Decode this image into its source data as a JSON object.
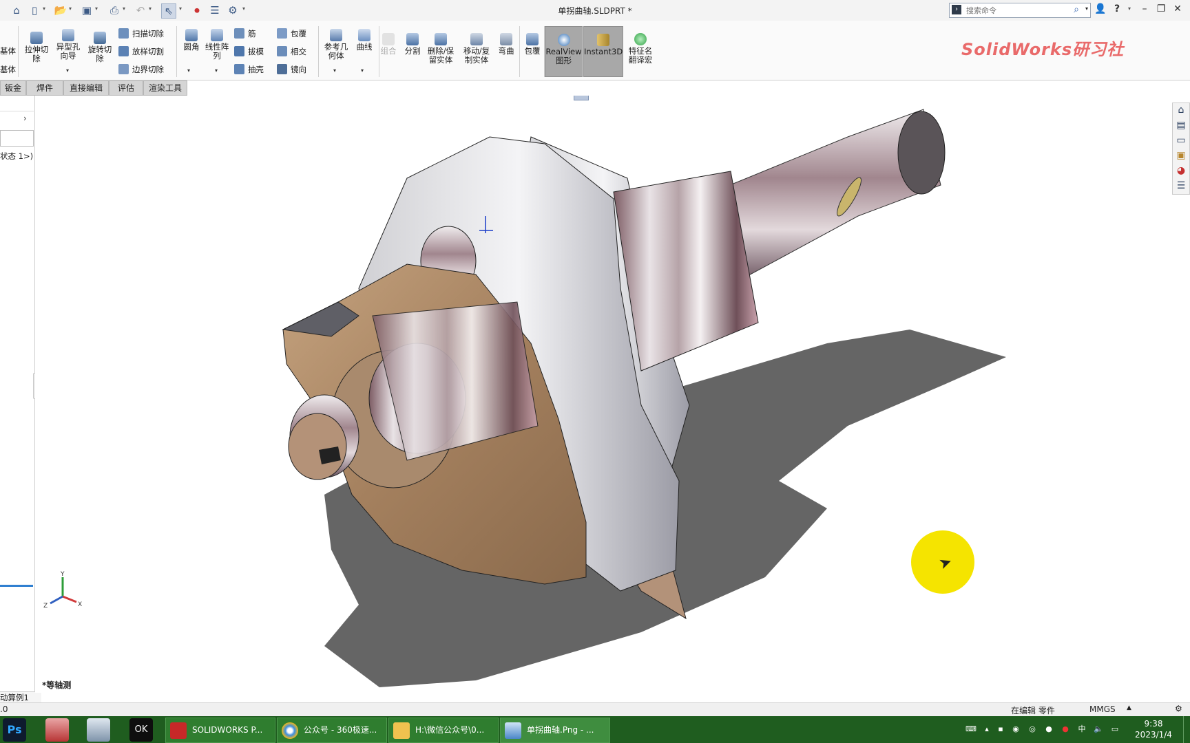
{
  "title_bar": {
    "document_title": "单拐曲轴.SLDPRT *",
    "search_placeholder": "搜索命令",
    "help": "?",
    "quick_access_icons": [
      "home-icon",
      "new-document-icon",
      "open-icon",
      "save-icon",
      "print-icon",
      "undo-icon",
      "select-icon",
      "rebuild-icon",
      "file-properties-icon",
      "options-icon"
    ]
  },
  "ribbon": {
    "left_partial": [
      "基体",
      "基体"
    ],
    "cut_group": {
      "extrude_cut": "拉伸切除",
      "hole_wizard": "异型孔向导",
      "revolve_cut": "旋转切除",
      "sweep_cut": "扫描切除",
      "loft_cut": "放样切割",
      "boundary_cut": "边界切除"
    },
    "feature_group": {
      "fillet": "圆角",
      "linear_pattern": "线性阵列",
      "rib": "筋",
      "draft": "拔模",
      "shell": "抽壳",
      "wrap": "包覆",
      "intersect": "相交",
      "mirror": "镜向"
    },
    "ref_group": {
      "ref_geometry": "参考几何体",
      "curves": "曲线"
    },
    "body_group": {
      "combine": "组合",
      "split": "分割",
      "delete_keep": "删除/保留实体",
      "move_copy": "移动/复制实体",
      "flex": "弯曲",
      "wrap2": "包覆"
    },
    "view_group": {
      "realview": "RealView图形",
      "instant3d": "Instant3D",
      "feature_translate": "特征名翻译宏"
    },
    "brand_watermark": "SolidWorks研习社"
  },
  "tabs": [
    "钣金",
    "焊件",
    "直接编辑",
    "评估",
    "渲染工具"
  ],
  "left_panel": {
    "partial_text": "状态 1>)",
    "config_text": "动算例1",
    "version_fragment": ".0"
  },
  "viewport": {
    "view_label": "*等轴测",
    "triad_axes": [
      "Y",
      "X",
      "Z"
    ],
    "heads_up_toolbar": [
      "view-orientation-icon",
      "zoom-to-fit-icon",
      "zoom-to-area-icon",
      "previous-view-icon",
      "section-view-icon",
      "dynamic-annotation-icon",
      "display-style-icon",
      "hide-show-icon",
      "edit-appearance-icon",
      "apply-scene-icon",
      "view-settings-icon"
    ],
    "task_pane_icons": [
      "resources-home-icon",
      "design-library-icon",
      "file-explorer-icon",
      "view-palette-icon",
      "appearances-icon",
      "custom-properties-icon"
    ]
  },
  "status_bar": {
    "editing": "在编辑 零件",
    "units": "MMGS"
  },
  "taskbar": {
    "tasks": [
      {
        "label": "SOLIDWORKS P..."
      },
      {
        "label": "公众号 - 360极速..."
      },
      {
        "label": "H:\\微信公众号\\0..."
      },
      {
        "label": "单拐曲轴.Png - ..."
      }
    ],
    "clock_time": "9:38",
    "clock_date": "2023/1/4"
  }
}
